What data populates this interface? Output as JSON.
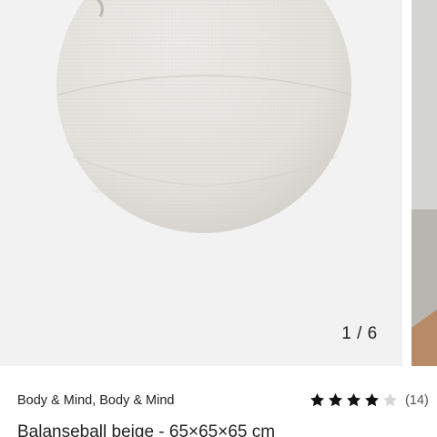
{
  "gallery": {
    "counter": "1 / 6"
  },
  "product": {
    "brand": "Body & Mind, Body & Mind",
    "rating": {
      "value": 4,
      "max": 5,
      "count_label": "(14)"
    },
    "title": "Balanseball beige - 65×65×65 cm"
  },
  "colors": {
    "star_filled": "#111111",
    "star_empty": "#d6d6d6",
    "gallery_bg": "#f2f2f2",
    "ball": "#e6e4df"
  },
  "icons": [
    "star-icon",
    "star-empty-icon"
  ]
}
